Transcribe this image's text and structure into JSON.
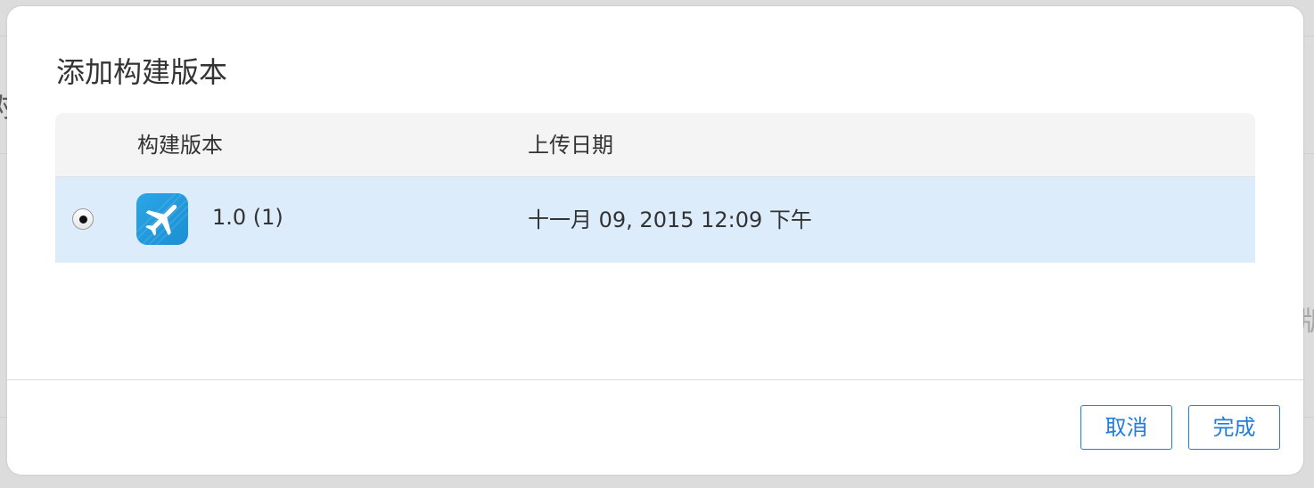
{
  "dialog": {
    "title": "添加构建版本"
  },
  "table": {
    "columns": {
      "build": "构建版本",
      "upload_date": "上传日期"
    },
    "rows": [
      {
        "selected": true,
        "icon": "airplane-app-icon",
        "build_version": "1.0 (1)",
        "upload_date": "十一月 09, 2015 12:09 下午"
      }
    ]
  },
  "footer": {
    "cancel_label": "取消",
    "done_label": "完成"
  },
  "colors": {
    "accent": "#1f7ddb",
    "selected_row": "#ddecfb",
    "header_bg": "#f4f4f4",
    "app_icon": "#1b8fd3"
  }
}
